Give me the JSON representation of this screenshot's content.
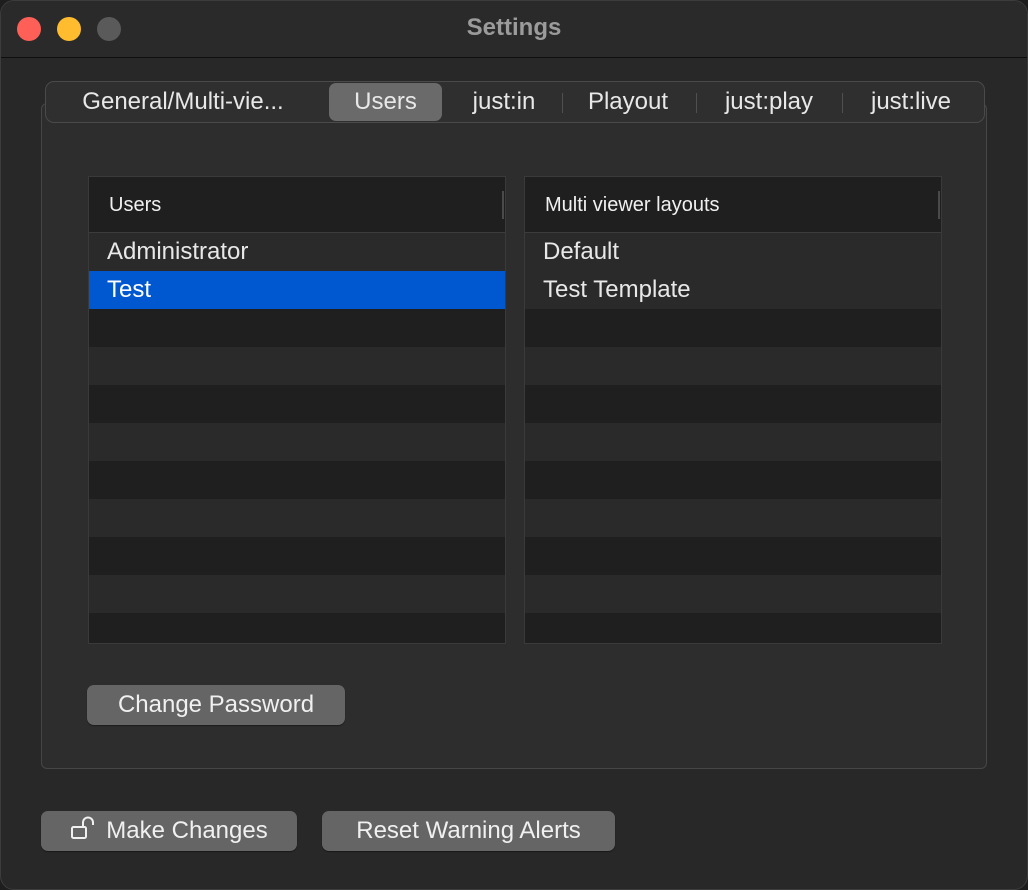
{
  "window": {
    "title": "Settings"
  },
  "tabs": [
    {
      "label": "General/Multi-vie..."
    },
    {
      "label": "Users",
      "active": true
    },
    {
      "label": "just:in"
    },
    {
      "label": "Playout"
    },
    {
      "label": "just:play"
    },
    {
      "label": "just:live"
    }
  ],
  "users_table": {
    "header": "Users",
    "rows": [
      "Administrator",
      "Test"
    ],
    "selected_index": 1
  },
  "layouts_table": {
    "header": "Multi viewer layouts",
    "rows": [
      "Default",
      "Test Template"
    ]
  },
  "buttons": {
    "change_password": "Change Password",
    "make_changes": "Make Changes",
    "reset_warning_alerts": "Reset Warning Alerts"
  },
  "colors": {
    "selection": "#0058d0",
    "close": "#fe5f57",
    "minimize": "#febc2e",
    "zoom_disabled": "#5a5a5a"
  },
  "icons": {
    "make_changes": "unlock-icon"
  }
}
